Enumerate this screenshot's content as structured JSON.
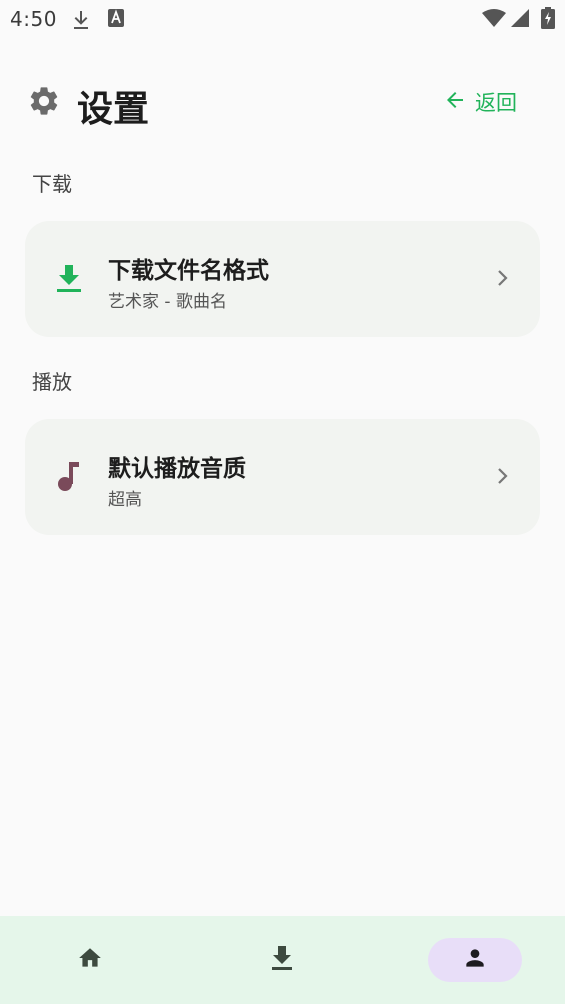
{
  "status_bar": {
    "time": "4:50",
    "icons": [
      "download-icon",
      "a-icon",
      "wifi-icon",
      "signal-icon",
      "battery-icon"
    ]
  },
  "header": {
    "title": "设置",
    "back_label": "返回",
    "accent_color": "#21b35a"
  },
  "sections": [
    {
      "header": "下载",
      "items": [
        {
          "title": "下载文件名格式",
          "subtitle": "艺术家 - 歌曲名",
          "icon": "download-icon",
          "icon_color": "#21b35a"
        }
      ]
    },
    {
      "header": "播放",
      "items": [
        {
          "title": "默认播放音质",
          "subtitle": "超高",
          "icon": "music-note-icon",
          "icon_color": "#7a4a5a"
        }
      ]
    }
  ],
  "bottom_nav": {
    "items": [
      {
        "icon": "home-icon",
        "selected": false
      },
      {
        "icon": "download-icon",
        "selected": false
      },
      {
        "icon": "person-icon",
        "selected": true
      }
    ],
    "selected_bg": "#e8def8",
    "background": "#e5f6ea"
  }
}
